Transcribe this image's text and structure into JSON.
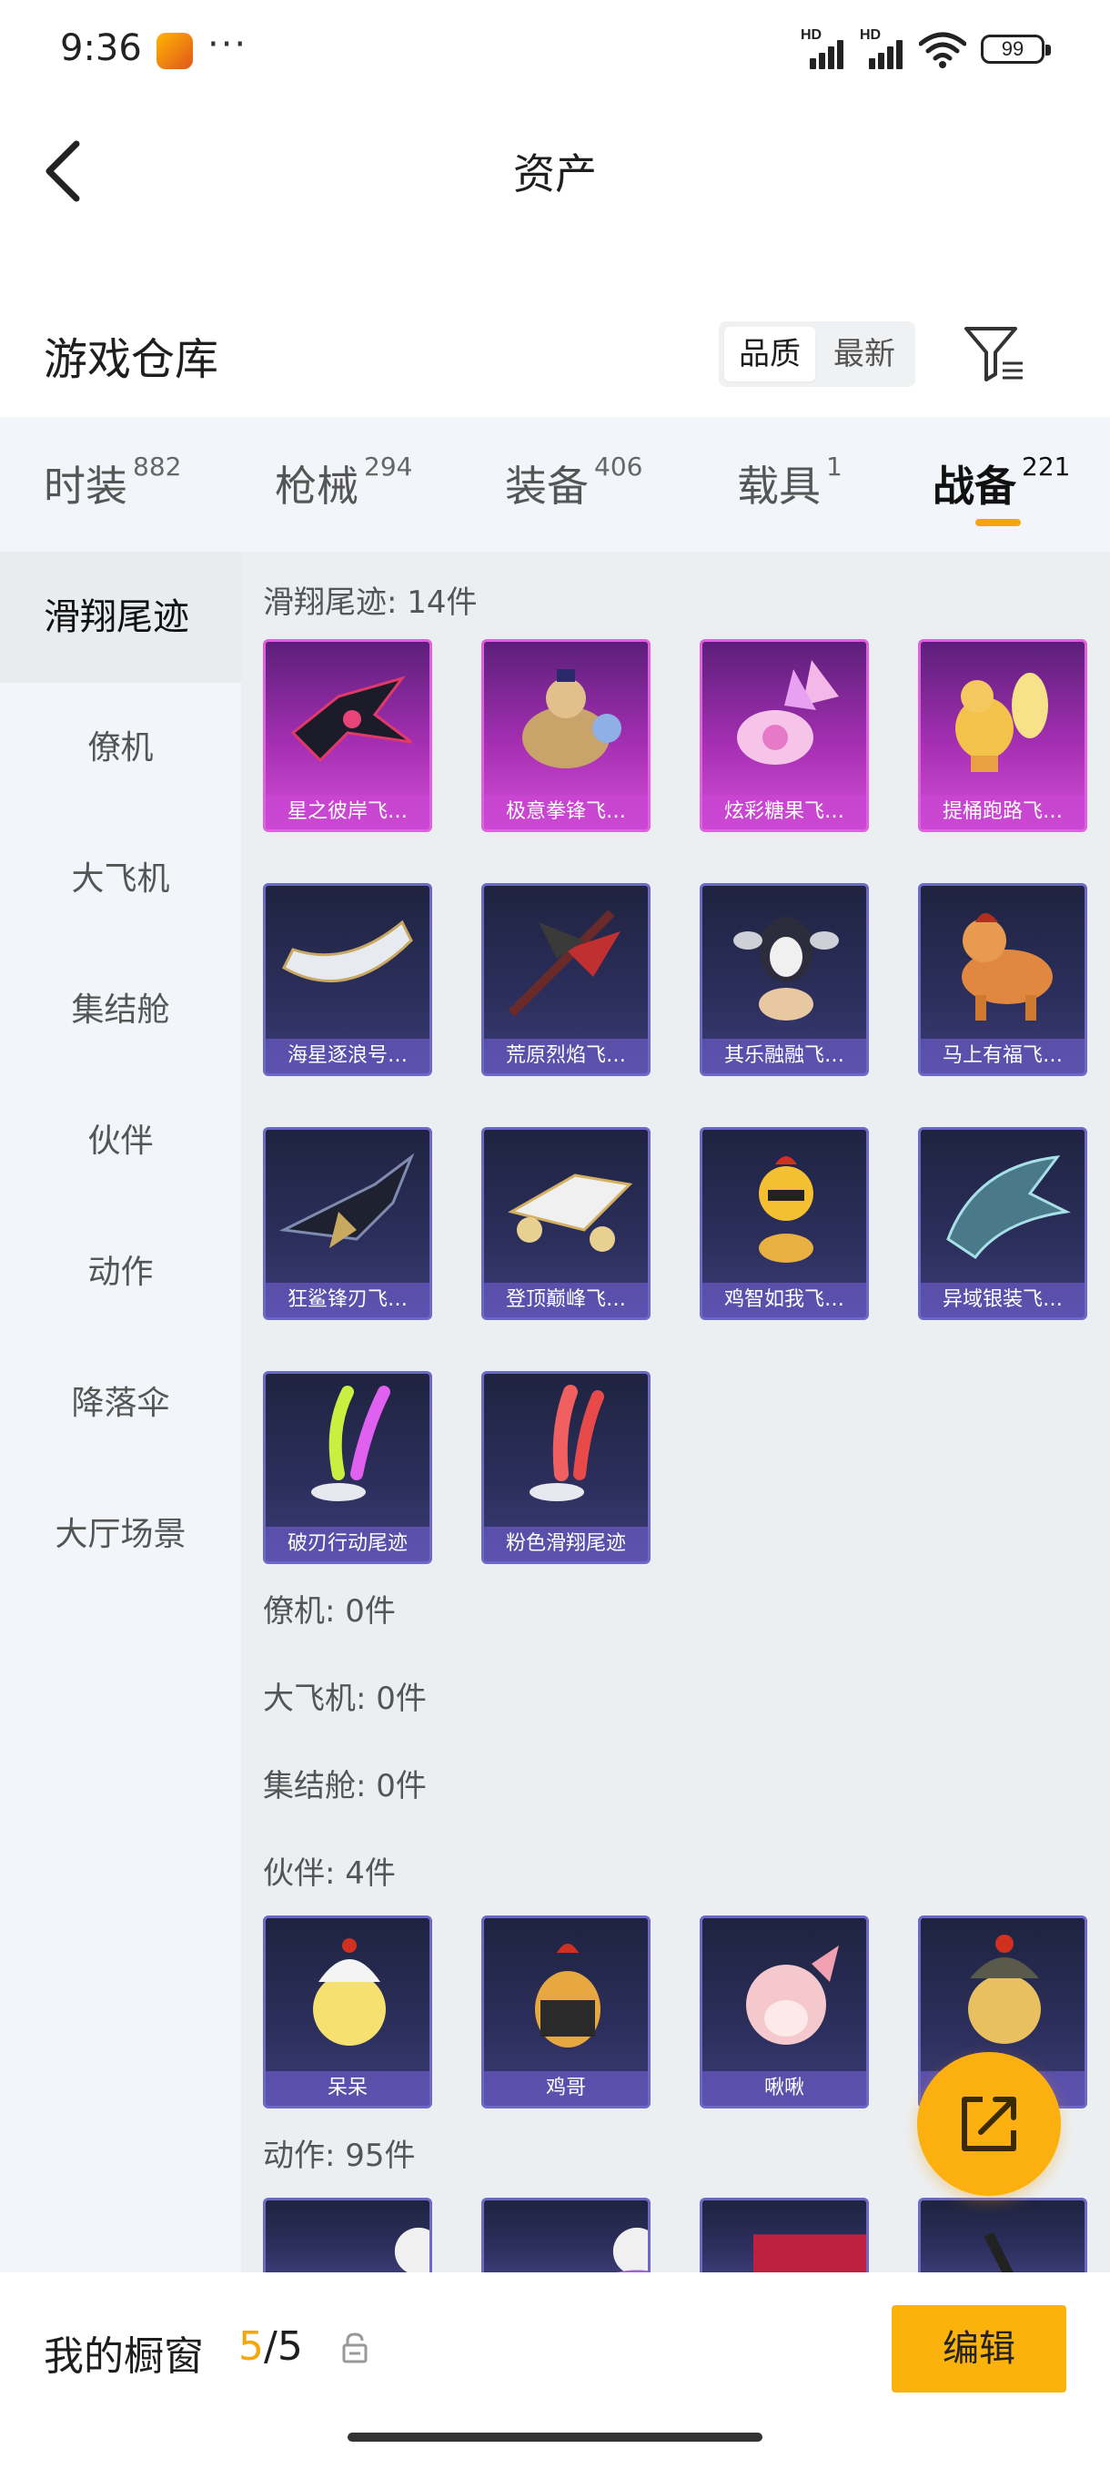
{
  "status_bar": {
    "time": "9:36",
    "dots": "···",
    "signal_1_label": "HD",
    "signal_2_label": "HD",
    "battery": "99"
  },
  "header": {
    "title": "资产",
    "back_icon": "chevron-left-icon"
  },
  "warehouse": {
    "title": "游戏仓库",
    "sort_options": [
      "品质",
      "最新"
    ],
    "selected_sort": "品质",
    "filter_icon": "filter-icon"
  },
  "tabs": [
    {
      "label": "时装",
      "count": "882"
    },
    {
      "label": "枪械",
      "count": "294"
    },
    {
      "label": "装备",
      "count": "406"
    },
    {
      "label": "载具",
      "count": "1"
    },
    {
      "label": "战备",
      "count": "221"
    }
  ],
  "active_tab": "战备",
  "sidebar": {
    "items": [
      "滑翔尾迹",
      "僚机",
      "大飞机",
      "集结舱",
      "伙伴",
      "动作",
      "降落伞",
      "大厅场景"
    ],
    "active": "滑翔尾迹"
  },
  "groups": {
    "glide_trail": {
      "title": "滑翔尾迹: 14件",
      "items": [
        {
          "name": "星之彼岸飞…",
          "rarity": "purple"
        },
        {
          "name": "极意拳锋飞…",
          "rarity": "purple"
        },
        {
          "name": "炫彩糖果飞…",
          "rarity": "purple"
        },
        {
          "name": "提桶跑路飞…",
          "rarity": "purple"
        },
        {
          "name": "海星逐浪号…",
          "rarity": "blue"
        },
        {
          "name": "荒原烈焰飞…",
          "rarity": "blue"
        },
        {
          "name": "其乐融融飞…",
          "rarity": "blue"
        },
        {
          "name": "马上有福飞…",
          "rarity": "blue"
        },
        {
          "name": "狂鲨锋刃飞…",
          "rarity": "blue"
        },
        {
          "name": "登顶巅峰飞…",
          "rarity": "blue"
        },
        {
          "name": "鸡智如我飞…",
          "rarity": "blue"
        },
        {
          "name": "异域银装飞…",
          "rarity": "blue"
        },
        {
          "name": "破刃行动尾迹",
          "rarity": "blue"
        },
        {
          "name": "粉色滑翔尾迹",
          "rarity": "blue"
        }
      ]
    },
    "wingman": {
      "title": "僚机: 0件"
    },
    "big_plane": {
      "title": "大飞机: 0件"
    },
    "assembly_pod": {
      "title": "集结舱: 0件"
    },
    "partner": {
      "title": "伙伴: 4件",
      "items": [
        {
          "name": "呆呆",
          "rarity": "blue"
        },
        {
          "name": "鸡哥",
          "rarity": "blue"
        },
        {
          "name": "啾啾",
          "rarity": "blue"
        },
        {
          "name": "",
          "rarity": "blue"
        }
      ]
    },
    "action": {
      "title": "动作: 95件"
    }
  },
  "fab": {
    "icon": "share-external-icon"
  },
  "bottom": {
    "showcase_label": "我的橱窗",
    "showcase_current": "5",
    "showcase_total": "/5",
    "lock_icon": "lock-icon",
    "edit_label": "编辑"
  },
  "colors": {
    "accent": "#f5a70a",
    "edit_button": "#fbb30c",
    "purple_rarity": "#d24fd6",
    "blue_rarity": "#6b68c8"
  }
}
